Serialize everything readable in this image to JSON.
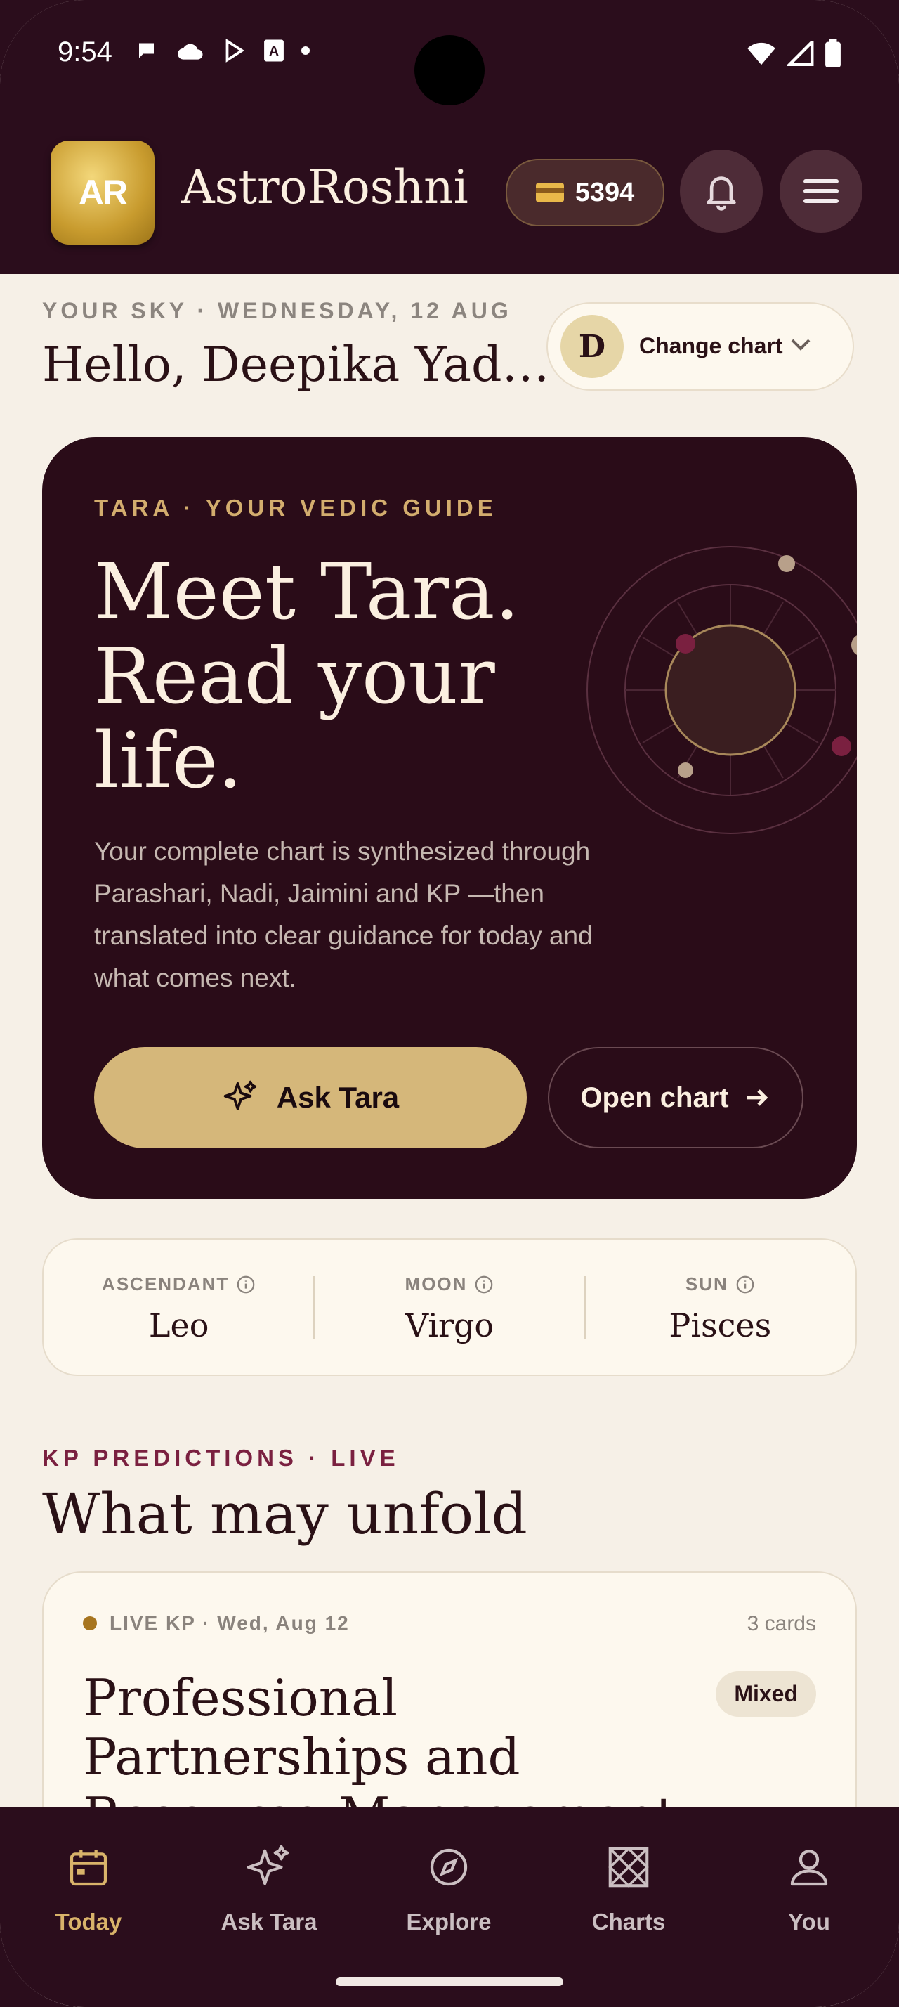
{
  "status": {
    "time": "9:54"
  },
  "header": {
    "logo_text": "AR",
    "app_name": "AstroRoshni",
    "coins": "5394"
  },
  "greeting": {
    "date_line": "YOUR SKY · WEDNESDAY, 12 AUG",
    "hello": "Hello, Deepika Yad…"
  },
  "chart_switch": {
    "avatar_initial": "D",
    "label": "Change chart"
  },
  "hero": {
    "kicker": "TARA · YOUR VEDIC GUIDE",
    "title_line1": "Meet Tara.",
    "title_line2": "Read your",
    "title_line3": "life.",
    "description": "Your complete chart is synthesized through Parashari, Nadi, Jaimini and KP —then translated into clear guidance for today and what comes next.",
    "ask_button": "Ask Tara",
    "open_button": "Open chart"
  },
  "signs": [
    {
      "label": "ASCENDANT",
      "value": "Leo"
    },
    {
      "label": "MOON",
      "value": "Virgo"
    },
    {
      "label": "SUN",
      "value": "Pisces"
    }
  ],
  "predictions": {
    "kicker": "KP PREDICTIONS · LIVE",
    "heading": "What may unfold",
    "card": {
      "live_label": "LIVE KP · Wed, Aug 12",
      "count": "3 cards",
      "badge": "Mixed",
      "title": "Professional Partnerships and Resource Management"
    }
  },
  "nav": [
    {
      "label": "Today",
      "icon": "calendar-icon",
      "active": true
    },
    {
      "label": "Ask Tara",
      "icon": "sparkles-icon",
      "active": false
    },
    {
      "label": "Explore",
      "icon": "compass-icon",
      "active": false
    },
    {
      "label": "Charts",
      "icon": "chart-grid-icon",
      "active": false
    },
    {
      "label": "You",
      "icon": "person-icon",
      "active": false
    }
  ],
  "colors": {
    "brand_dark": "#2b0d1c",
    "gold": "#d5b77a",
    "accent": "#7a2040",
    "background": "#f6f0e7"
  }
}
